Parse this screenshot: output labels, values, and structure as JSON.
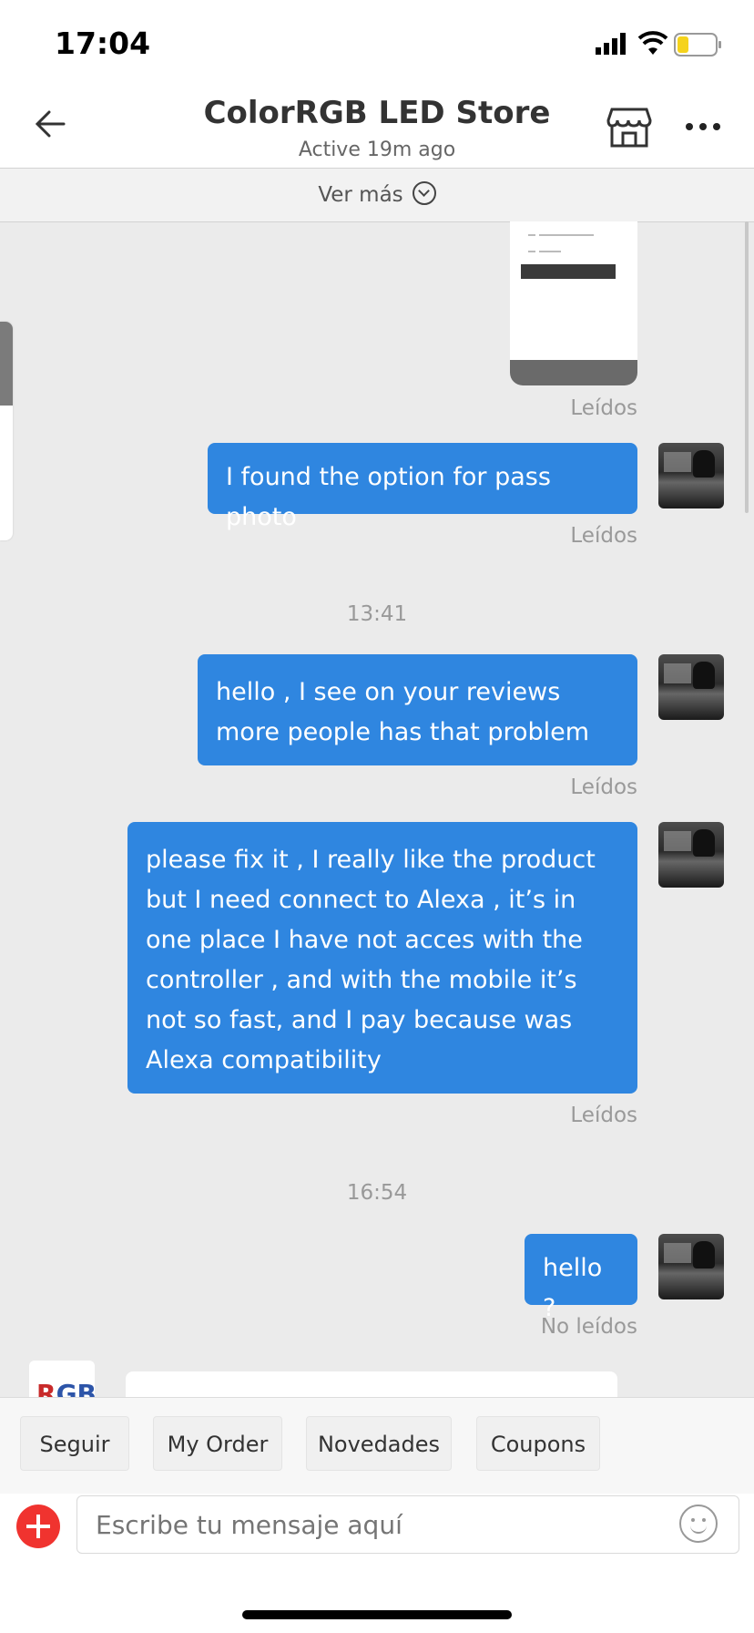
{
  "status_bar": {
    "time": "17:04"
  },
  "header": {
    "title": "ColorRGB LED Store",
    "subtitle": "Active 19m ago"
  },
  "ver_mas": {
    "label": "Ver más"
  },
  "messages": {
    "m1": {
      "text": "I found the option for pass photo",
      "status": "Leídos"
    },
    "t1": "13:41",
    "m2": {
      "text": "hello , I see on your reviews more people has that problem",
      "status": "Leídos"
    },
    "m3": {
      "text": "please fix it , I really like the product but I need connect to Alexa , it’s in one place I have not acces with the controller , and with the mobile it’s not so fast, and I pay because was Alexa compatibility",
      "status": "Leídos"
    },
    "t2": "16:54",
    "m4": {
      "text": "hello ?",
      "status": "No leídos"
    },
    "image_status": "Leídos"
  },
  "quick_actions": {
    "follow": "Seguir",
    "my_order": "My Order",
    "news": "Novedades",
    "coupons": "Coupons"
  },
  "composer": {
    "placeholder": "Escribe tu mensaje aquí"
  },
  "store_logo": {
    "text_r": "R",
    "text_gb": "GB"
  },
  "colors": {
    "bubble": "#2f86e0",
    "background": "#ebebeb",
    "plus": "#f0332f",
    "battery": "#f5d31c"
  }
}
